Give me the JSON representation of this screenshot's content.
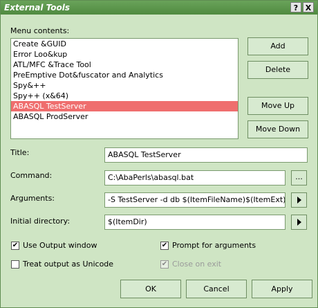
{
  "window": {
    "title": "External Tools",
    "help_label": "?",
    "close_label": "X"
  },
  "menu": {
    "label": "Menu contents:",
    "items": [
      {
        "label": "Create &GUID"
      },
      {
        "label": "Error Loo&kup"
      },
      {
        "label": "ATL/MFC &Trace Tool"
      },
      {
        "label": "PreEmptive Dot&fuscator and Analytics"
      },
      {
        "label": "Spy&++"
      },
      {
        "label": "Spy++ (x&64)"
      },
      {
        "label": "ABASQL TestServer"
      },
      {
        "label": "ABASQL ProdServer"
      }
    ],
    "selected_index": 6
  },
  "buttons": {
    "add": "Add",
    "delete": "Delete",
    "move_up": "Move Up",
    "move_down": "Move Down",
    "browse": "...",
    "ok": "OK",
    "cancel": "Cancel",
    "apply": "Apply"
  },
  "fields": {
    "title_label": "Title:",
    "title_value": "ABASQL TestServer",
    "command_label": "Command:",
    "command_value": "C:\\AbaPerls\\abasql.bat",
    "arguments_label": "Arguments:",
    "arguments_value": "-S TestServer -d db $(ItemFileName)$(ItemExt)",
    "initdir_label": "Initial directory:",
    "initdir_value": "$(ItemDir)"
  },
  "options": {
    "use_output": {
      "label": "Use Output window",
      "checked": true
    },
    "prompt_args": {
      "label": "Prompt for arguments",
      "checked": true
    },
    "unicode": {
      "label": "Treat output as Unicode",
      "checked": false
    },
    "close_on_exit": {
      "label": "Close on exit",
      "checked": true,
      "disabled": true
    }
  },
  "colors": {
    "accent": "#4f8a40",
    "selection": "#ef6e6e",
    "dialog_bg": "#cfe5c4"
  },
  "icons": {
    "arrow": "triangle-right-icon",
    "check": "checkmark-icon"
  }
}
